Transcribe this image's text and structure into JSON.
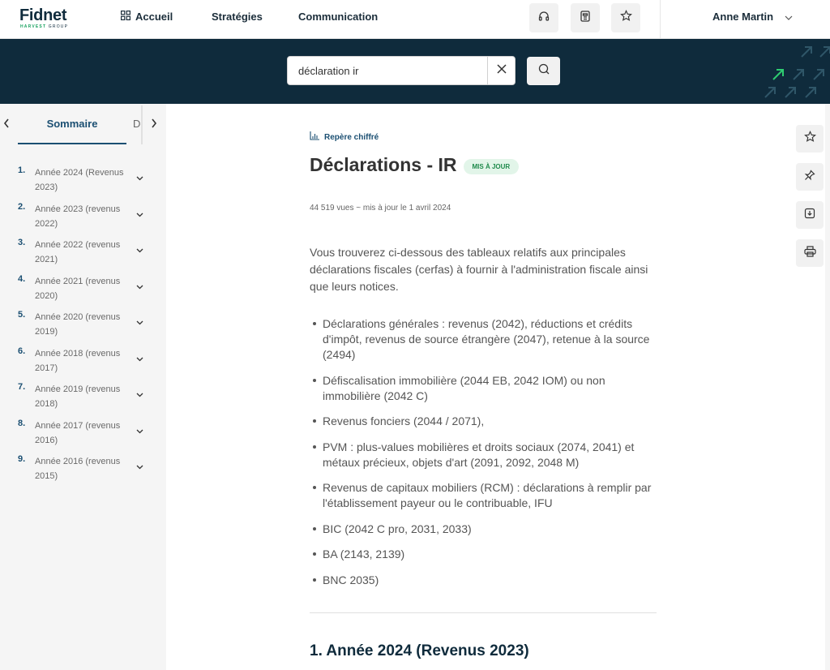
{
  "brand": {
    "name": "Fidnet",
    "sub_left": "HARVEST",
    "sub_right": " GROUP"
  },
  "nav": {
    "home": "Accueil",
    "strategies": "Stratégies",
    "communication": "Communication",
    "user": "Anne Martin",
    "icons": [
      "headset-icon",
      "document-icon",
      "star-icon"
    ]
  },
  "search": {
    "value": "déclaration ir"
  },
  "sidebar": {
    "tab_active": "Sommaire",
    "tab_partial": "Do",
    "items": [
      {
        "num": "1.",
        "label": "Année 2024 (Revenus 2023)"
      },
      {
        "num": "2.",
        "label": "Année 2023 (revenus 2022)"
      },
      {
        "num": "3.",
        "label": "Année 2022 (revenus 2021)"
      },
      {
        "num": "4.",
        "label": "Année 2021 (revenus 2020)"
      },
      {
        "num": "5.",
        "label": "Année 2020 (revenus 2019)"
      },
      {
        "num": "6.",
        "label": "Année 2018 (revenus 2017)"
      },
      {
        "num": "7.",
        "label": "Année 2019 (revenus 2018)"
      },
      {
        "num": "8.",
        "label": "Année 2017 (revenus 2016)"
      },
      {
        "num": "9.",
        "label": "Année 2016 (revenus 2015)"
      }
    ]
  },
  "article": {
    "kicker": "Repère chiffré",
    "title": "Déclarations - IR",
    "badge": "MIS À JOUR",
    "meta": "44 519 vues ~ mis à jour le 1 avril 2024",
    "intro": "Vous trouverez ci-dessous des tableaux relatifs aux principales déclarations fiscales (cerfas) à fournir à l'administration fiscale ainsi que leurs notices.",
    "bullets": [
      "Déclarations générales : revenus (2042), réductions et crédits d'impôt, revenus de source étrangère (2047), retenue à la source (2494)",
      "Défiscalisation immobilière (2044 EB, 2042 IOM) ou non immobilière (2042 C)",
      "Revenus fonciers (2044 / 2071),",
      "PVM : plus-values mobilières et droits sociaux (2074, 2041) et métaux précieux, objets d'art (2091, 2092, 2048 M)",
      "Revenus de capitaux mobiliers (RCM) : déclarations à remplir par l'établissement payeur ou le contribuable, IFU",
      "BIC (2042 C pro, 2031, 2033)",
      "BA (2143, 2139)",
      "BNC 2035)"
    ],
    "section_title": "1. Année 2024 (Revenus 2023)"
  },
  "tools": [
    "star-icon",
    "pin-icon",
    "download-icon",
    "print-icon"
  ],
  "colors": {
    "navy": "#0f2b3c",
    "accent": "#1b4f72",
    "green": "#1f8a4c",
    "badge_bg": "#e2f5e9"
  }
}
